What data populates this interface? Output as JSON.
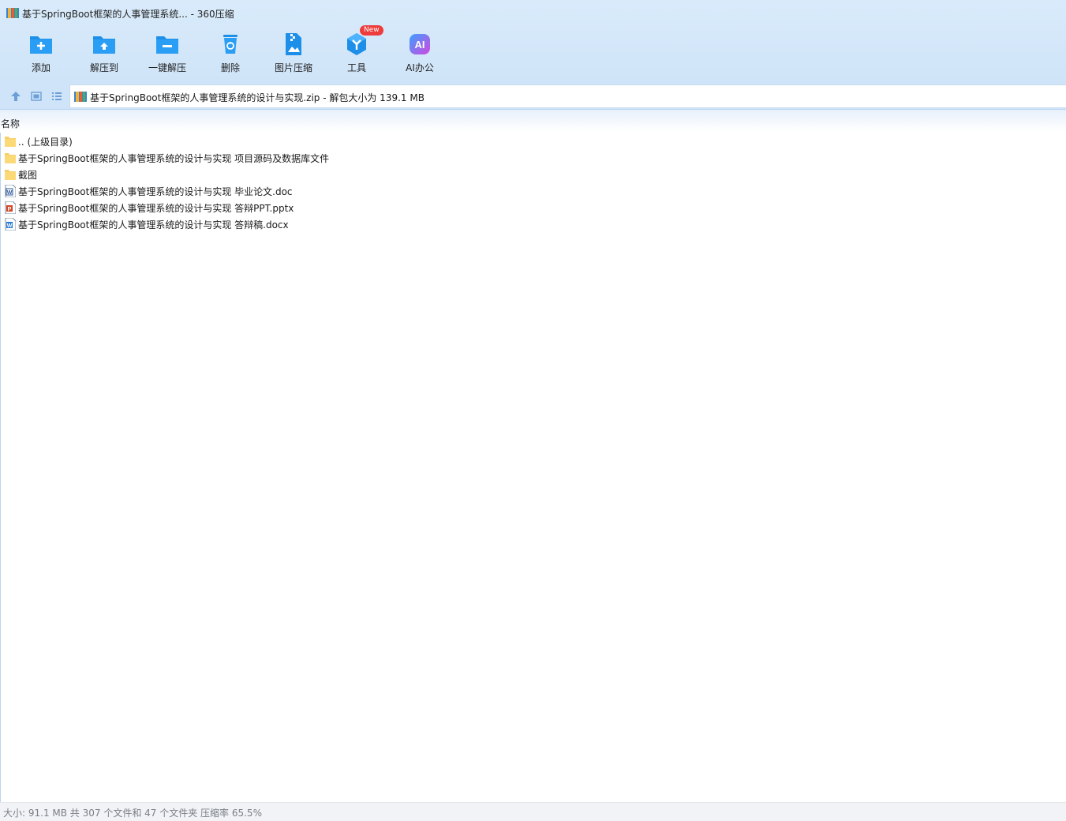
{
  "window": {
    "title": "基于SpringBoot框架的人事管理系统... - 360压缩"
  },
  "toolbar": {
    "items": [
      {
        "label": "添加",
        "icon": "add-archive-icon"
      },
      {
        "label": "解压到",
        "icon": "extract-to-icon"
      },
      {
        "label": "一键解压",
        "icon": "one-click-extract-icon"
      },
      {
        "label": "删除",
        "icon": "recycle-bin-icon"
      },
      {
        "label": "图片压缩",
        "icon": "image-compress-icon"
      },
      {
        "label": "工具",
        "icon": "tools-cube-icon",
        "badge": "New"
      },
      {
        "label": "AI办公",
        "icon": "ai-office-icon"
      }
    ]
  },
  "nav": {
    "path": "基于SpringBoot框架的人事管理系统的设计与实现.zip - 解包大小为 139.1 MB"
  },
  "list": {
    "column_header": "名称",
    "items": [
      {
        "name": ".. (上级目录)",
        "type": "folder"
      },
      {
        "name": "基于SpringBoot框架的人事管理系统的设计与实现 项目源码及数据库文件",
        "type": "folder"
      },
      {
        "name": "截图",
        "type": "folder"
      },
      {
        "name": "基于SpringBoot框架的人事管理系统的设计与实现 毕业论文.doc",
        "type": "doc"
      },
      {
        "name": "基于SpringBoot框架的人事管理系统的设计与实现 答辩PPT.pptx",
        "type": "pptx"
      },
      {
        "name": "基于SpringBoot框架的人事管理系统的设计与实现 答辩稿.docx",
        "type": "docx"
      }
    ]
  },
  "status": {
    "text": "大小: 91.1 MB 共 307 个文件和 47 个文件夹 压缩率 65.5%"
  },
  "colors": {
    "header_bg": "#d9ebfb",
    "accent_blue": "#1e8fe8",
    "badge_red": "#ee3b3b",
    "folder_yellow": "#f7cf6a"
  }
}
